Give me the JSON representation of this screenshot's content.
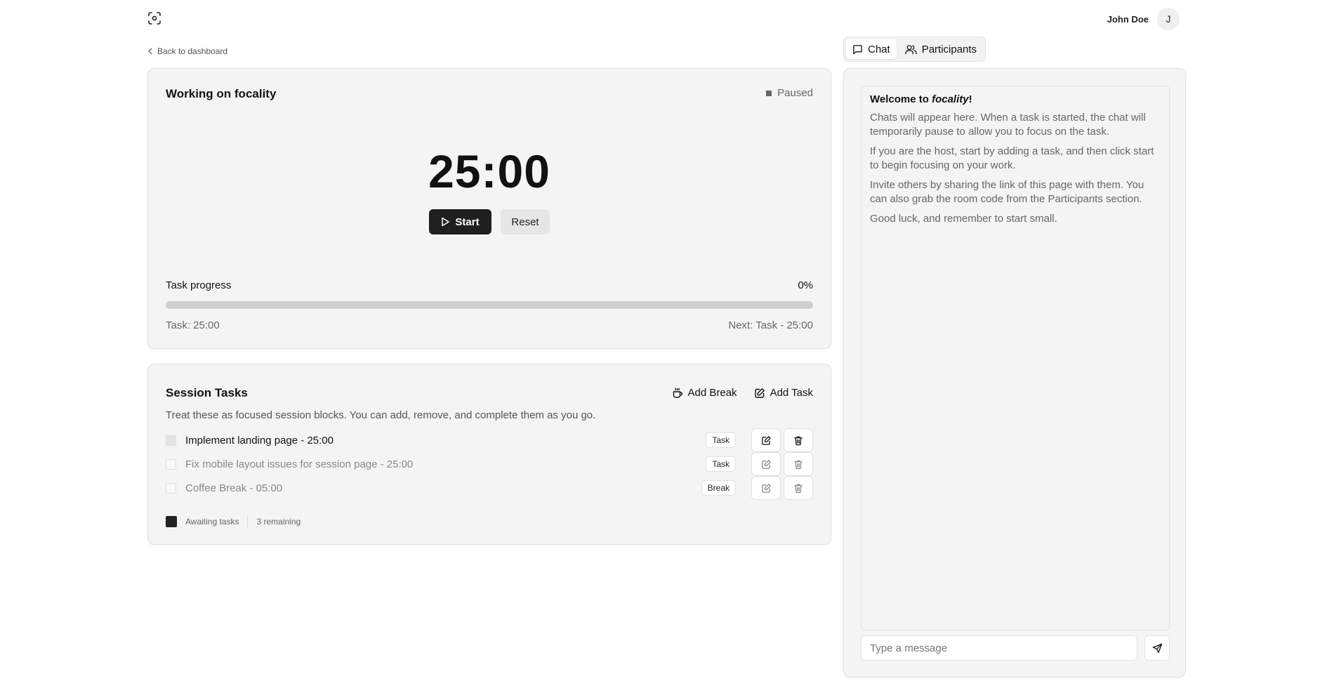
{
  "header": {
    "logo_icon": "focus-scan-icon",
    "user_name": "John Doe",
    "avatar_initial": "J"
  },
  "nav": {
    "back_label": "Back to dashboard"
  },
  "timer": {
    "title": "Working on focality",
    "status": "Paused",
    "time": "25:00",
    "start_label": "Start",
    "reset_label": "Reset",
    "progress_label": "Task progress",
    "progress_text": "0%",
    "progress_value": 0,
    "task_info": "Task: 25:00",
    "next_info": "Next: Task - 25:00"
  },
  "session": {
    "title": "Session Tasks",
    "add_break_label": "Add Break",
    "add_task_label": "Add Task",
    "description": "Treat these as focused session blocks. You can add, remove, and complete them as you go.",
    "tasks": [
      {
        "label": "Implement landing page - 25:00",
        "type": "Task",
        "active": true
      },
      {
        "label": "Fix mobile layout issues for session page - 25:00",
        "type": "Task",
        "active": false
      },
      {
        "label": "Coffee Break - 05:00",
        "type": "Break",
        "active": false
      }
    ],
    "footer_status": "Awaiting tasks",
    "footer_remaining": "3 remaining"
  },
  "chat": {
    "tabs": [
      {
        "label": "Chat",
        "icon": "message-square-icon",
        "selected": true
      },
      {
        "label": "Participants",
        "icon": "users-icon",
        "selected": false
      }
    ],
    "welcome_prefix": "Welcome to ",
    "welcome_brand": "focality",
    "welcome_suffix": "!",
    "messages": [
      "Chats will appear here. When a task is started, the chat will temporarily pause to allow you to focus on the task.",
      "If you are the host, start by adding a task, and then click start to begin focusing on your work.",
      "Invite others by sharing the link of this page with them. You can also grab the room code from the Participants section.",
      "Good luck, and remember to start small."
    ],
    "input_placeholder": "Type a message"
  }
}
